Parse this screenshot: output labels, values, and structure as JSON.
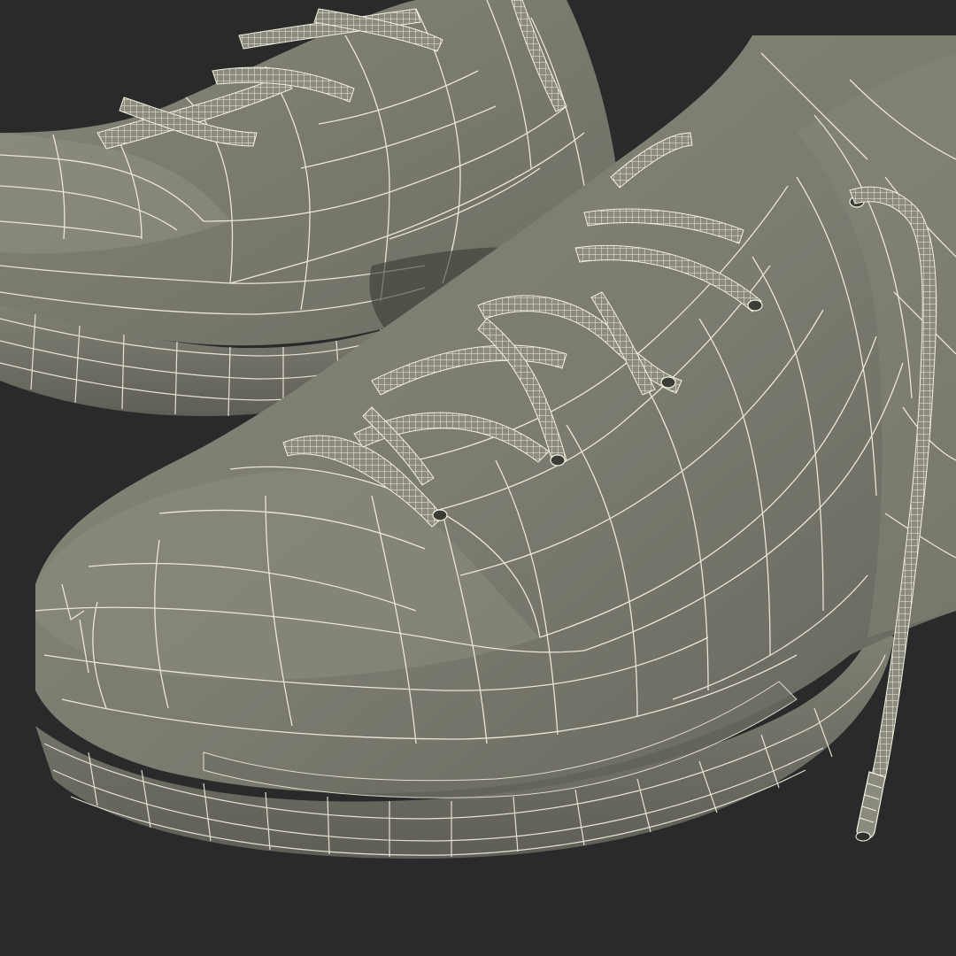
{
  "scene": {
    "subject": "wireframe-shoes-3d-render",
    "colors": {
      "background": "#2a2a2a",
      "surface": "#7d7d72",
      "surface_dark": "#6a6a60",
      "surface_light": "#8e8e83",
      "shadow": "#3f3f3a",
      "wire": "#f2f0df"
    },
    "icons": [
      "shoe-left-icon",
      "shoe-right-icon",
      "shoelace-icon",
      "aglet-icon"
    ]
  }
}
